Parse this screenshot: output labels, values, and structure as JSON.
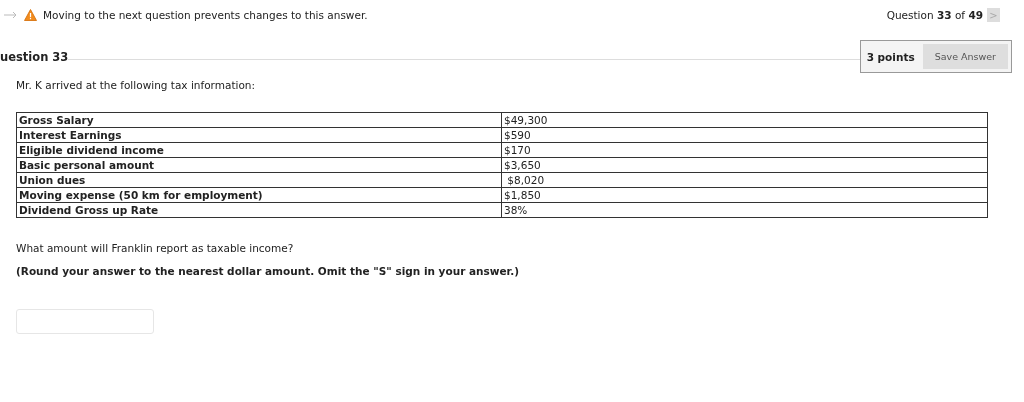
{
  "warning": {
    "text": "Moving to the next question prevents changes to this answer."
  },
  "progress": {
    "text": "Question **33** of **49**",
    "next_label": ">",
    "next_disabled": true
  },
  "question": {
    "title": "uestion 33",
    "points": "3 points",
    "save_label": "Save Answer"
  },
  "intro": "Mr. K arrived at the following tax information:",
  "table": {
    "rows": [
      {
        "label": "Gross Salary",
        "value": "$49,300"
      },
      {
        "label": "Interest Earnings",
        "value": "$590"
      },
      {
        "label": "Eligible dividend income",
        "value": "$170"
      },
      {
        "label": "Basic personal amount",
        "value": "$3,650"
      },
      {
        "label": "Union dues",
        "value": " $8,020"
      },
      {
        "label": "Moving expense (50 km for employment)",
        "value": "$1,850"
      },
      {
        "label": "Dividend Gross up Rate",
        "value": "38%"
      }
    ]
  },
  "prompt": "What amount will Franklin report as taxable income?",
  "instruction": "(Round your answer to the nearest dollar amount. Omit the \"S\" sign in your answer.)"
}
